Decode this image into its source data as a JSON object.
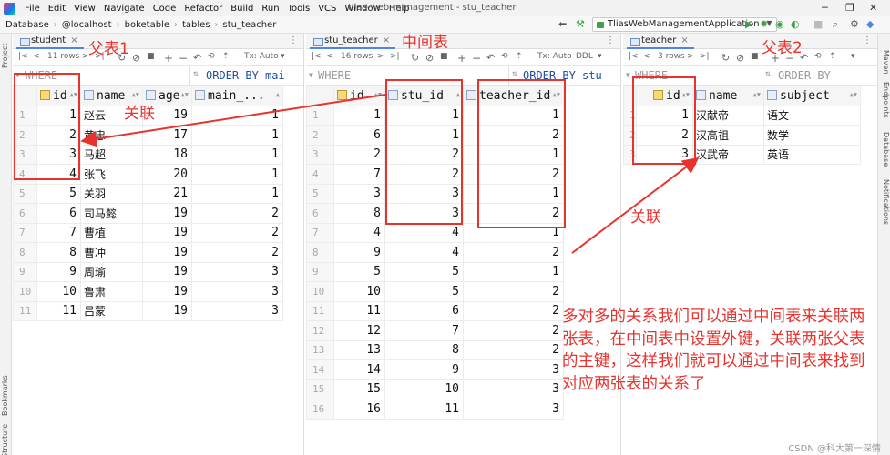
{
  "window": {
    "title": "tlias-web-management - stu_teacher"
  },
  "menu": [
    "File",
    "Edit",
    "View",
    "Navigate",
    "Code",
    "Refactor",
    "Build",
    "Run",
    "Tools",
    "VCS",
    "Window",
    "Help"
  ],
  "breadcrumb": [
    "Database",
    "@localhost",
    "boketable",
    "tables",
    "stu_teacher"
  ],
  "run_config": "TliasWebManagementApplication",
  "sidebar_left": [
    "Project",
    "Bookmarks",
    "Structure"
  ],
  "sidebar_right": [
    "Maven",
    "Endpoints",
    "Database",
    "Notifications"
  ],
  "panels": {
    "student": {
      "tab": "student",
      "rows_label": "11 rows",
      "tx_label": "Tx: Auto",
      "where": "WHERE",
      "order_by": "ORDER BY mai",
      "columns": [
        "id",
        "name",
        "age",
        "main_..."
      ],
      "rows": [
        [
          "1",
          "1",
          "赵云",
          "19",
          "1"
        ],
        [
          "2",
          "2",
          "黄忠",
          "17",
          "1"
        ],
        [
          "3",
          "3",
          "马超",
          "18",
          "1"
        ],
        [
          "4",
          "4",
          "张飞",
          "20",
          "1"
        ],
        [
          "5",
          "5",
          "关羽",
          "21",
          "1"
        ],
        [
          "6",
          "6",
          "司马懿",
          "19",
          "2"
        ],
        [
          "7",
          "7",
          "曹植",
          "19",
          "2"
        ],
        [
          "8",
          "8",
          "曹冲",
          "19",
          "2"
        ],
        [
          "9",
          "9",
          "周瑜",
          "19",
          "3"
        ],
        [
          "10",
          "10",
          "鲁肃",
          "19",
          "3"
        ],
        [
          "11",
          "11",
          "吕蒙",
          "19",
          "3"
        ]
      ]
    },
    "stu_teacher": {
      "tab": "stu_teacher",
      "rows_label": "16 rows",
      "tx_label": "Tx: Auto",
      "ddl": "DDL",
      "where": "WHERE",
      "order_by": "ORDER BY stu",
      "columns": [
        "id",
        "stu_id",
        "teacher_id"
      ],
      "rows": [
        [
          "1",
          "1",
          "1",
          "1"
        ],
        [
          "2",
          "6",
          "1",
          "2"
        ],
        [
          "3",
          "2",
          "2",
          "1"
        ],
        [
          "4",
          "7",
          "2",
          "2"
        ],
        [
          "5",
          "3",
          "3",
          "1"
        ],
        [
          "6",
          "8",
          "3",
          "2"
        ],
        [
          "7",
          "4",
          "4",
          "1"
        ],
        [
          "8",
          "9",
          "4",
          "2"
        ],
        [
          "9",
          "5",
          "5",
          "1"
        ],
        [
          "10",
          "10",
          "5",
          "2"
        ],
        [
          "11",
          "11",
          "6",
          "2"
        ],
        [
          "12",
          "12",
          "7",
          "2"
        ],
        [
          "13",
          "13",
          "8",
          "2"
        ],
        [
          "14",
          "14",
          "9",
          "3"
        ],
        [
          "15",
          "15",
          "10",
          "3"
        ],
        [
          "16",
          "16",
          "11",
          "3"
        ]
      ]
    },
    "teacher": {
      "tab": "teacher",
      "rows_label": "3 rows",
      "tx_label": "Tx: Auto",
      "where": "WHERE",
      "order_by": "ORDER BY",
      "columns": [
        "id",
        "name",
        "subject"
      ],
      "rows": [
        [
          "1",
          "1",
          "汉献帝",
          "语文"
        ],
        [
          "2",
          "2",
          "汉高祖",
          "数学"
        ],
        [
          "3",
          "3",
          "汉武帝",
          "英语"
        ]
      ]
    }
  },
  "annotations": {
    "parent1": "父表1",
    "middle": "中间表",
    "parent2": "父表2",
    "relate_left": "关联",
    "relate_right": "关联",
    "note": "多对多的关系我们可以通过中间表来关联两张表，在中间表中设置外键，关联两张父表的主键，这样我们就可以通过中间表来找到对应两张表的关系了",
    "accent_color": "#e8322d"
  },
  "watermark": "CSDN @科大第一深情"
}
